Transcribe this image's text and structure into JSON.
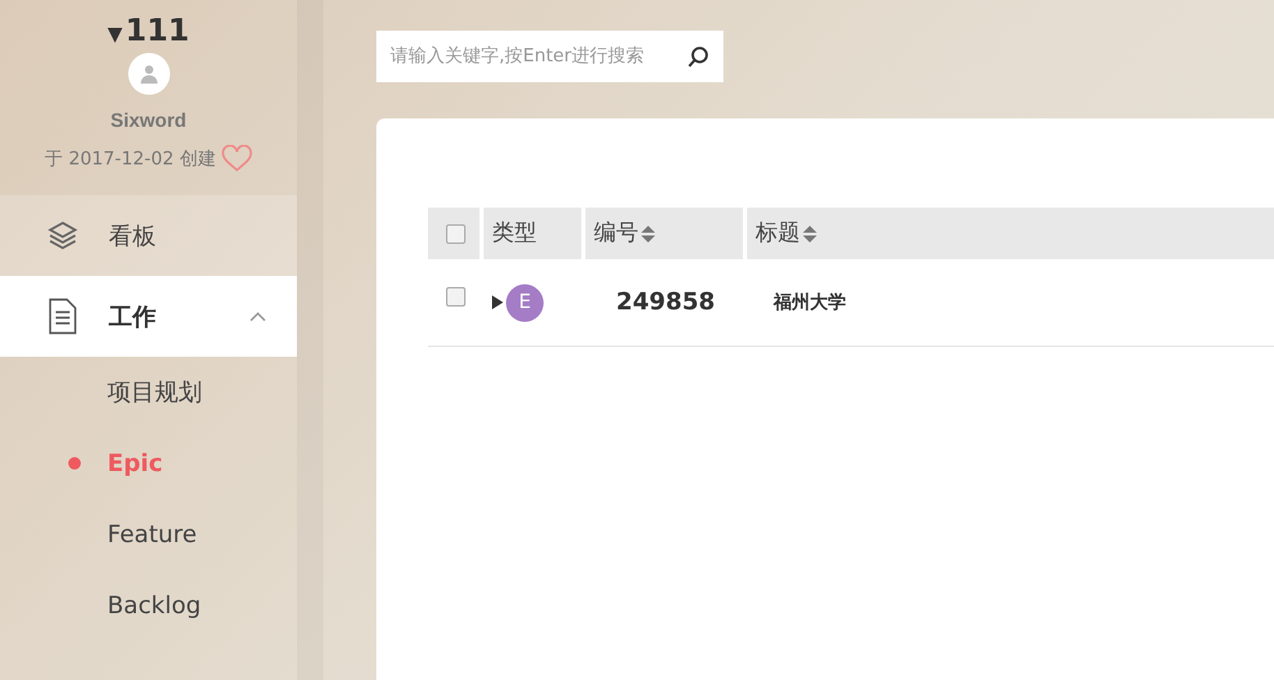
{
  "project": {
    "toggle": "▼",
    "title": "111",
    "owner": "Sixword",
    "created": "于 2017-12-02 创建",
    "favorite": false
  },
  "nav": [
    {
      "label": "看板",
      "selected": false
    },
    {
      "label": "工作",
      "selected": true,
      "expanded": true,
      "children": [
        {
          "label": "项目规划",
          "selected": false
        },
        {
          "label": "Epic",
          "selected": true
        },
        {
          "label": "Feature",
          "selected": false
        },
        {
          "label": "Backlog",
          "selected": false
        }
      ]
    }
  ],
  "search": {
    "placeholder": "请输入关键字,按Enter进行搜索"
  },
  "table": {
    "select_all": {
      "checked": false
    },
    "columns": [
      {
        "label": "类型",
        "sortable": false
      },
      {
        "label": "编号",
        "sortable": true
      },
      {
        "label": "标题",
        "sortable": true
      }
    ],
    "rows": [
      {
        "checked": false,
        "expanded": false,
        "type": "E",
        "color": "#a57cc6",
        "number": "249858",
        "title": "福州大学"
      }
    ]
  }
}
